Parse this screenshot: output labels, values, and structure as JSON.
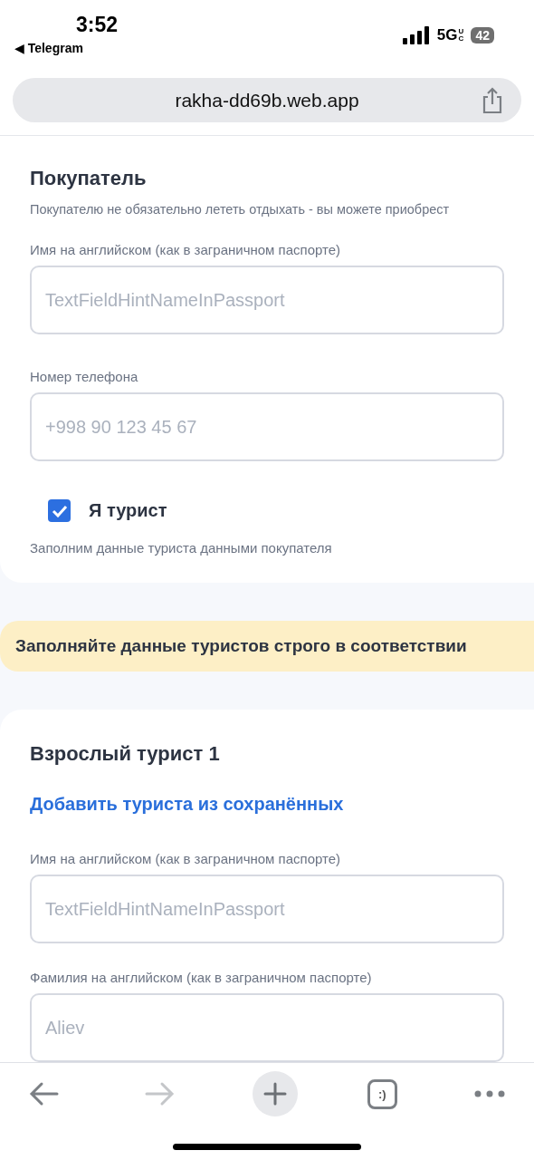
{
  "status_bar": {
    "time": "3:52",
    "back_app": "◀ Telegram",
    "network": "5G",
    "network_sub": "UC",
    "battery": "42"
  },
  "address_bar": {
    "url": "rakha-dd69b.web.app"
  },
  "buyer_card": {
    "title": "Покупатель",
    "subtitle": "Покупателю не обязательно лететь отдыхать - вы можете приобрест",
    "fields": [
      {
        "label": "Имя на английском (как в заграничном паспорте)",
        "placeholder": "TextFieldHintNameInPassport"
      },
      {
        "label": "Номер телефона",
        "placeholder": "+998 90 123 45 67"
      }
    ],
    "tourist_checkbox": {
      "label": "Я турист",
      "checked": true
    },
    "hint": "Заполним данные туриста данными покупателя"
  },
  "notice": "Заполняйте данные туристов строго в соответствии",
  "tourist_card": {
    "title": "Взрослый турист 1",
    "add_link": "Добавить туриста из сохранённых",
    "fields": [
      {
        "label": "Имя на английском (как в заграничном паспорте)",
        "placeholder": "TextFieldHintNameInPassport"
      },
      {
        "label": "Фамилия на английском (как в заграничном паспорте)",
        "placeholder": "Aliev"
      }
    ]
  },
  "toolbar": {
    "forward_disabled": true,
    "tabs_label": ":)"
  }
}
